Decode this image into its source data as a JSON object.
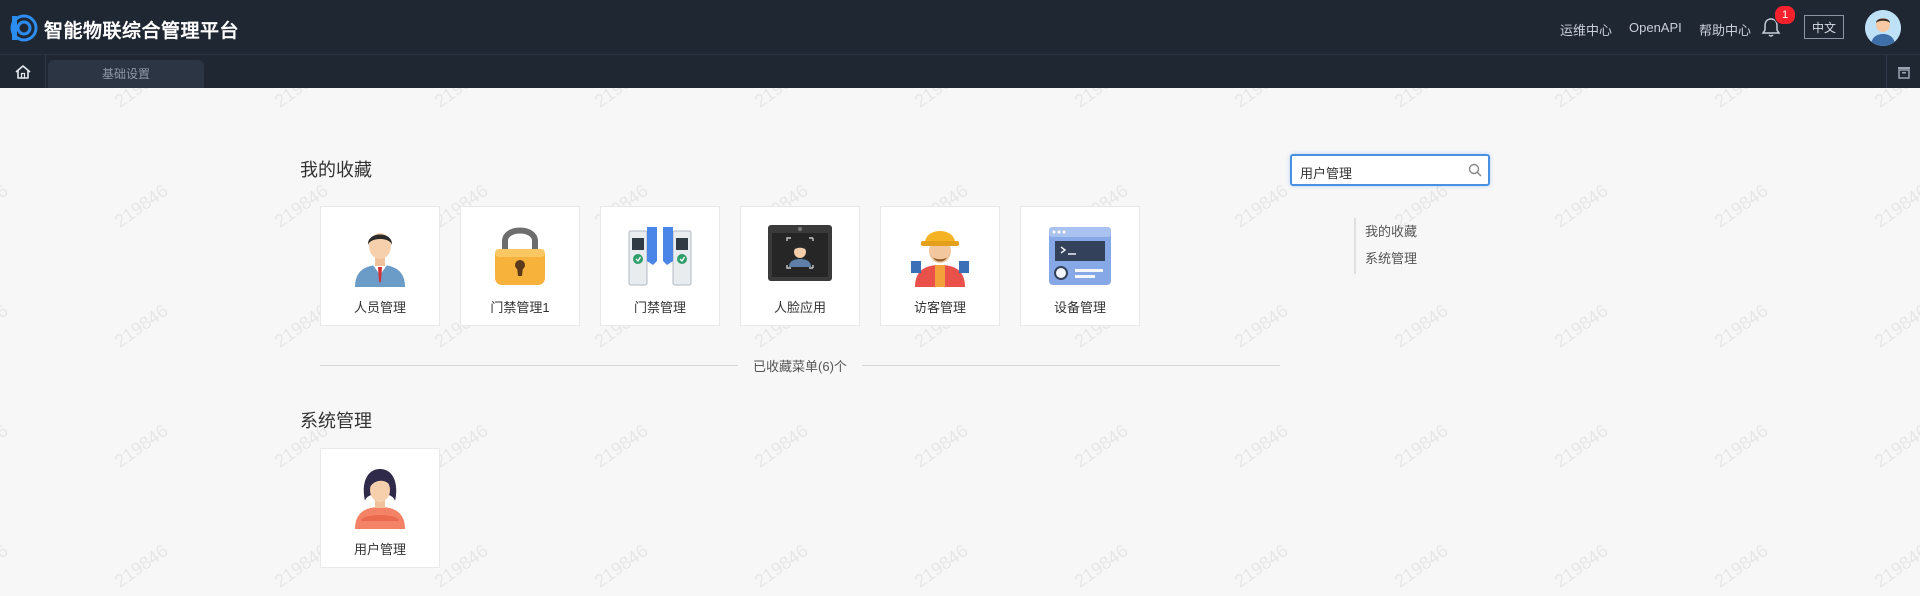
{
  "header": {
    "app_title": "智能物联综合管理平台",
    "links": [
      "运维中心",
      "OpenAPI",
      "帮助中心"
    ],
    "notification_count": "1",
    "language": "中文"
  },
  "tabs": {
    "active_tab": "基础设置"
  },
  "search": {
    "value": "用户管理"
  },
  "favorites": {
    "title": "我的收藏",
    "items": [
      {
        "label": "人员管理",
        "icon": "person-manager-icon"
      },
      {
        "label": "门禁管理1",
        "icon": "padlock-icon"
      },
      {
        "label": "门禁管理",
        "icon": "turnstile-icon"
      },
      {
        "label": "人脸应用",
        "icon": "face-terminal-icon"
      },
      {
        "label": "访客管理",
        "icon": "visitor-icon"
      },
      {
        "label": "设备管理",
        "icon": "device-icon"
      }
    ],
    "summary": "已收藏菜单(6)个"
  },
  "system": {
    "title": "系统管理",
    "items": [
      {
        "label": "用户管理",
        "icon": "user-manager-icon"
      }
    ]
  },
  "anchor_nav": [
    "我的收藏",
    "系统管理"
  ],
  "watermark_text": "219846",
  "colors": {
    "header_bg": "#1f2733",
    "accent": "#4a90e2",
    "badge": "#f5222d",
    "page_bg": "#f7f7f7"
  }
}
